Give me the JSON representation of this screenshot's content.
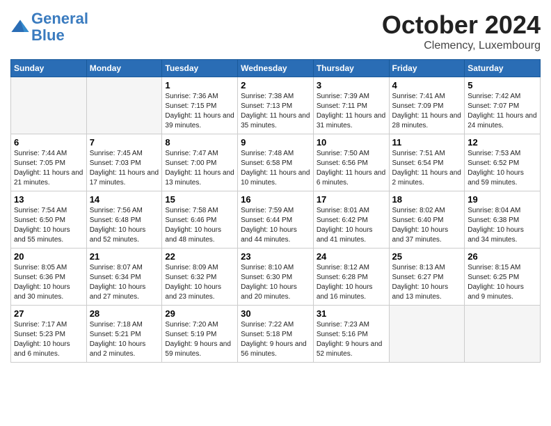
{
  "header": {
    "logo_line1": "General",
    "logo_line2": "Blue",
    "month": "October 2024",
    "location": "Clemency, Luxembourg"
  },
  "weekdays": [
    "Sunday",
    "Monday",
    "Tuesday",
    "Wednesday",
    "Thursday",
    "Friday",
    "Saturday"
  ],
  "weeks": [
    [
      {
        "day": "",
        "info": ""
      },
      {
        "day": "",
        "info": ""
      },
      {
        "day": "1",
        "info": "Sunrise: 7:36 AM\nSunset: 7:15 PM\nDaylight: 11 hours and 39 minutes."
      },
      {
        "day": "2",
        "info": "Sunrise: 7:38 AM\nSunset: 7:13 PM\nDaylight: 11 hours and 35 minutes."
      },
      {
        "day": "3",
        "info": "Sunrise: 7:39 AM\nSunset: 7:11 PM\nDaylight: 11 hours and 31 minutes."
      },
      {
        "day": "4",
        "info": "Sunrise: 7:41 AM\nSunset: 7:09 PM\nDaylight: 11 hours and 28 minutes."
      },
      {
        "day": "5",
        "info": "Sunrise: 7:42 AM\nSunset: 7:07 PM\nDaylight: 11 hours and 24 minutes."
      }
    ],
    [
      {
        "day": "6",
        "info": "Sunrise: 7:44 AM\nSunset: 7:05 PM\nDaylight: 11 hours and 21 minutes."
      },
      {
        "day": "7",
        "info": "Sunrise: 7:45 AM\nSunset: 7:03 PM\nDaylight: 11 hours and 17 minutes."
      },
      {
        "day": "8",
        "info": "Sunrise: 7:47 AM\nSunset: 7:00 PM\nDaylight: 11 hours and 13 minutes."
      },
      {
        "day": "9",
        "info": "Sunrise: 7:48 AM\nSunset: 6:58 PM\nDaylight: 11 hours and 10 minutes."
      },
      {
        "day": "10",
        "info": "Sunrise: 7:50 AM\nSunset: 6:56 PM\nDaylight: 11 hours and 6 minutes."
      },
      {
        "day": "11",
        "info": "Sunrise: 7:51 AM\nSunset: 6:54 PM\nDaylight: 11 hours and 2 minutes."
      },
      {
        "day": "12",
        "info": "Sunrise: 7:53 AM\nSunset: 6:52 PM\nDaylight: 10 hours and 59 minutes."
      }
    ],
    [
      {
        "day": "13",
        "info": "Sunrise: 7:54 AM\nSunset: 6:50 PM\nDaylight: 10 hours and 55 minutes."
      },
      {
        "day": "14",
        "info": "Sunrise: 7:56 AM\nSunset: 6:48 PM\nDaylight: 10 hours and 52 minutes."
      },
      {
        "day": "15",
        "info": "Sunrise: 7:58 AM\nSunset: 6:46 PM\nDaylight: 10 hours and 48 minutes."
      },
      {
        "day": "16",
        "info": "Sunrise: 7:59 AM\nSunset: 6:44 PM\nDaylight: 10 hours and 44 minutes."
      },
      {
        "day": "17",
        "info": "Sunrise: 8:01 AM\nSunset: 6:42 PM\nDaylight: 10 hours and 41 minutes."
      },
      {
        "day": "18",
        "info": "Sunrise: 8:02 AM\nSunset: 6:40 PM\nDaylight: 10 hours and 37 minutes."
      },
      {
        "day": "19",
        "info": "Sunrise: 8:04 AM\nSunset: 6:38 PM\nDaylight: 10 hours and 34 minutes."
      }
    ],
    [
      {
        "day": "20",
        "info": "Sunrise: 8:05 AM\nSunset: 6:36 PM\nDaylight: 10 hours and 30 minutes."
      },
      {
        "day": "21",
        "info": "Sunrise: 8:07 AM\nSunset: 6:34 PM\nDaylight: 10 hours and 27 minutes."
      },
      {
        "day": "22",
        "info": "Sunrise: 8:09 AM\nSunset: 6:32 PM\nDaylight: 10 hours and 23 minutes."
      },
      {
        "day": "23",
        "info": "Sunrise: 8:10 AM\nSunset: 6:30 PM\nDaylight: 10 hours and 20 minutes."
      },
      {
        "day": "24",
        "info": "Sunrise: 8:12 AM\nSunset: 6:28 PM\nDaylight: 10 hours and 16 minutes."
      },
      {
        "day": "25",
        "info": "Sunrise: 8:13 AM\nSunset: 6:27 PM\nDaylight: 10 hours and 13 minutes."
      },
      {
        "day": "26",
        "info": "Sunrise: 8:15 AM\nSunset: 6:25 PM\nDaylight: 10 hours and 9 minutes."
      }
    ],
    [
      {
        "day": "27",
        "info": "Sunrise: 7:17 AM\nSunset: 5:23 PM\nDaylight: 10 hours and 6 minutes."
      },
      {
        "day": "28",
        "info": "Sunrise: 7:18 AM\nSunset: 5:21 PM\nDaylight: 10 hours and 2 minutes."
      },
      {
        "day": "29",
        "info": "Sunrise: 7:20 AM\nSunset: 5:19 PM\nDaylight: 9 hours and 59 minutes."
      },
      {
        "day": "30",
        "info": "Sunrise: 7:22 AM\nSunset: 5:18 PM\nDaylight: 9 hours and 56 minutes."
      },
      {
        "day": "31",
        "info": "Sunrise: 7:23 AM\nSunset: 5:16 PM\nDaylight: 9 hours and 52 minutes."
      },
      {
        "day": "",
        "info": ""
      },
      {
        "day": "",
        "info": ""
      }
    ]
  ]
}
